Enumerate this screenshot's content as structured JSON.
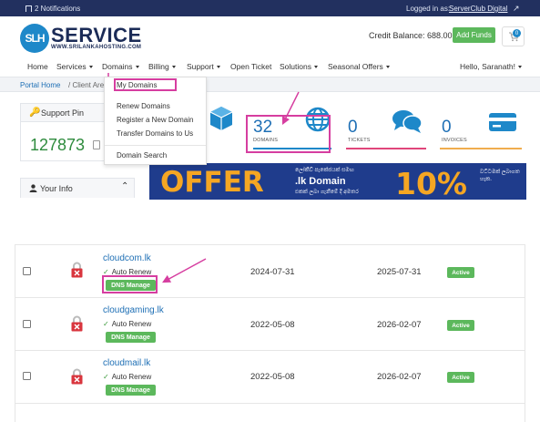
{
  "topbar": {
    "notifications": "2 Notifications",
    "logged_in_as": "Logged in as:",
    "user": "ServerClub Digital"
  },
  "header": {
    "logo_badge": "SLH",
    "logo_brand": "SERVICE",
    "logo_sub": "WWW.SRILANKAHOSTING.COM",
    "credit": "Credit Balance: 688.00",
    "add_funds": "Add Funds",
    "cart_count": "0"
  },
  "nav": {
    "items": [
      "Home",
      "Services",
      "Domains",
      "Billing",
      "Support",
      "Open Ticket",
      "Solutions",
      "Seasonal Offers"
    ],
    "greeting": "Hello, Saranath!"
  },
  "breadcrumb": {
    "home": "Portal Home",
    "current": "Client Area"
  },
  "domains_menu": {
    "items": [
      "My Domains",
      "Renew Domains",
      "Register a New Domain",
      "Transfer Domains to Us",
      "Domain Search"
    ]
  },
  "sidebar": {
    "support_pin_title": "Support Pin",
    "support_pin": "127873",
    "your_info_title": "Your Info"
  },
  "stats": [
    {
      "label": "DOMAINS",
      "value": "32"
    },
    {
      "label": "TICKETS",
      "value": "0"
    },
    {
      "label": "INVOICES",
      "value": "0"
    }
  ],
  "banner": {
    "offer": "OFFER",
    "line1": "ලෝකීව් පැකේජයක් සමඟ",
    "line2": ".lk Domain",
    "line3": "එකක් ලබා ගැනීමේ දී අමතර",
    "percent": "10%",
    "line4": "වට්ටමක් ලබාගත හැක."
  },
  "domains_table": {
    "rows": [
      {
        "domain": "cloudcom.lk",
        "auto_renew": "Auto Renew",
        "dns": "DNS Manage",
        "registered": "2024-07-31",
        "expiry": "2025-07-31",
        "status": "Active"
      },
      {
        "domain": "cloudgaming.lk",
        "auto_renew": "Auto Renew",
        "dns": "DNS Manage",
        "registered": "2022-05-08",
        "expiry": "2026-02-07",
        "status": "Active"
      },
      {
        "domain": "cloudmail.lk",
        "auto_renew": "Auto Renew",
        "dns": "DNS Manage",
        "registered": "2022-05-08",
        "expiry": "2026-02-07",
        "status": "Active"
      }
    ]
  },
  "colors": {
    "topbar": "#22305f",
    "accent": "#1e6fb5",
    "success": "#5cb85c",
    "highlight": "#d63ea0"
  }
}
